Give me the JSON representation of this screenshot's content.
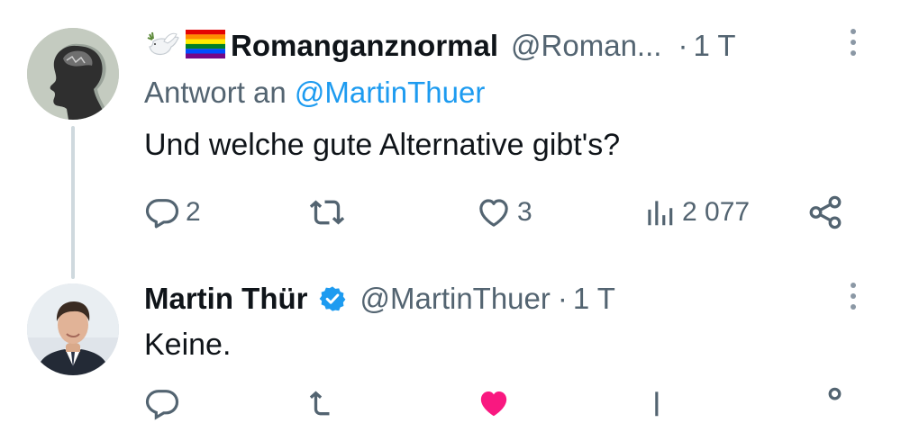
{
  "tweet1": {
    "emojis": [
      "dove-icon",
      "rainbow-flag-icon"
    ],
    "display_name": "Romanganznormal",
    "handle": "@Roman...",
    "separator": "·",
    "time": "1 T",
    "reply_prefix": "Antwort an",
    "reply_mention": "@MartinThuer",
    "text": "Und welche gute Alternative gibt's?",
    "actions": {
      "replies": "2",
      "retweets": "",
      "likes": "3",
      "views": "2 077"
    }
  },
  "tweet2": {
    "display_name": "Martin Thür",
    "verified": true,
    "handle": "@MartinThuer",
    "separator": "·",
    "time": "1 T",
    "text": "Keine."
  },
  "colors": {
    "text": "#0f1419",
    "secondary": "#536471",
    "accent": "#1d9bf0",
    "thread_line": "#cfd9de",
    "like_pink": "#f91880"
  }
}
